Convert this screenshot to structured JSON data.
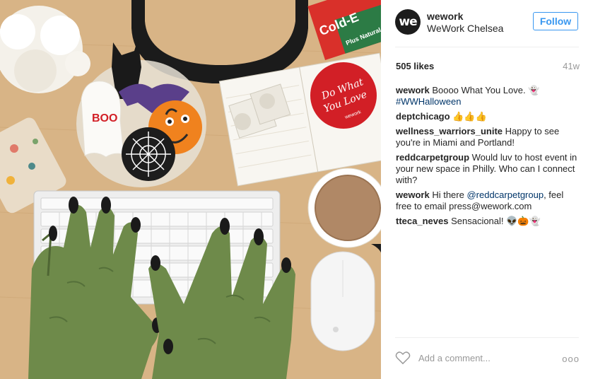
{
  "post": {
    "username": "wework",
    "location": "WeWork Chelsea",
    "avatar_text": "we",
    "follow_label": "Follow",
    "likes": "505 likes",
    "time_ago": "41w",
    "add_comment_placeholder": "Add a comment...",
    "more_label": "ooo",
    "photo_text": {
      "notebook_line1": "Do What",
      "notebook_line2": "You Love",
      "notebook_brand": "wework",
      "cookie_text": "BOO",
      "box_text": "Cold-E",
      "plus_text": "Plus Natural"
    }
  },
  "comments": [
    {
      "user": "wework",
      "text": "Boooo What You Love. 👻",
      "tag": "#WWHalloween",
      "after": ""
    },
    {
      "user": "deptchicago",
      "text": "👍👍👍",
      "tag": "",
      "after": ""
    },
    {
      "user": "wellness_warriors_unite",
      "text": "Happy to see you're in Miami and Portland!",
      "tag": "",
      "after": ""
    },
    {
      "user": "reddcarpetgroup",
      "text": "Would luv to host event in your new space in Philly. Who can I connect with?",
      "tag": "",
      "after": ""
    },
    {
      "user": "wework",
      "text": "Hi there",
      "tag": "@reddcarpetgroup",
      "after": ", feel free to email press@wework.com"
    },
    {
      "user": "tteca_neves",
      "text": "Sensacional! 👽🎃👻",
      "tag": "",
      "after": ""
    }
  ],
  "colors": {
    "follow_blue": "#3897f0",
    "tag_blue": "#003569",
    "stamp_red": "#d21f26",
    "glove_green": "#6e8a4a"
  }
}
